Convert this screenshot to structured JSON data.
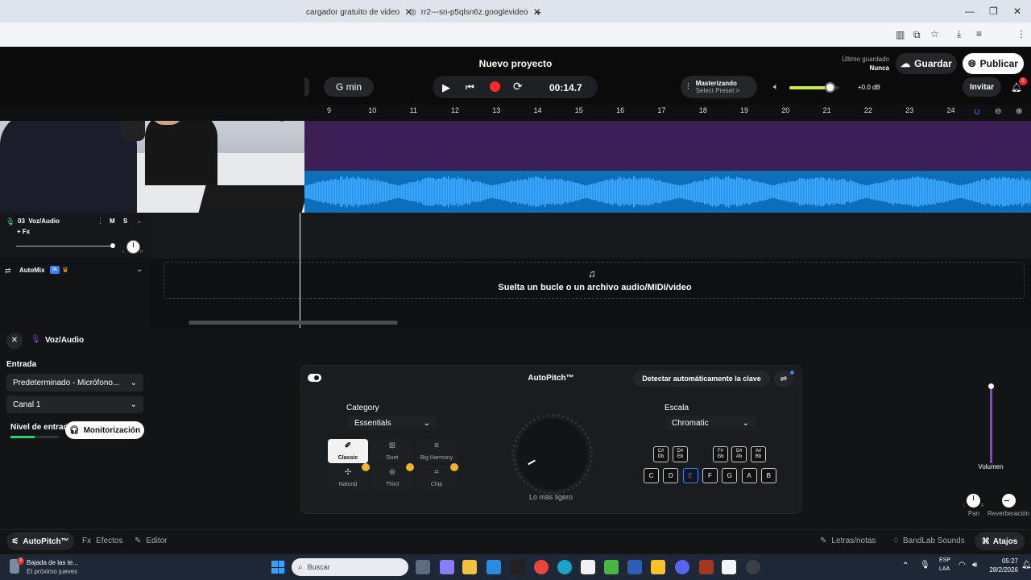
{
  "browser": {
    "tabs": [
      {
        "label": "cargador gratuito de video"
      },
      {
        "label": "rr2---sn-p5qlsn6z.googlevideo"
      }
    ],
    "new_tab": "+"
  },
  "header": {
    "project_title": "Nuevo proyecto",
    "key": "G min",
    "time": "00:14.7",
    "mastering_label": "Masterizando",
    "mastering_preset": "Select Preset >",
    "volume_db": "+0.0 dB",
    "last_saved_label": "Último guardado",
    "last_saved_value": "Nunca",
    "save_label": "Guardar",
    "publish_label": "Publicar",
    "invite_label": "Invitar",
    "notif_count": "1",
    "master_volume": 0.8
  },
  "ruler": [
    "9",
    "10",
    "11",
    "12",
    "13",
    "14",
    "15",
    "16",
    "17",
    "18",
    "19",
    "20",
    "21",
    "22",
    "23",
    "24"
  ],
  "track": {
    "name": "03  Voz/Audio",
    "m": "M",
    "s": "S",
    "fx": "+ Fx",
    "pan_l": "L",
    "pan_r": "R"
  },
  "automix": {
    "label": "AutoMix",
    "badge": "IA"
  },
  "dropzone": {
    "text": "Suelta un bucle o un archivo audio/MIDI/video"
  },
  "editor": {
    "title": "Voz/Audio",
    "input_label": "Entrada",
    "input_device": "Predeterminado - Micrófono...",
    "channel": "Canal 1",
    "level_label": "Nivel de entrada",
    "monitor_label": "Monitorización",
    "autopitch_title": "AutoPitch™",
    "detect_key": "Detectar automáticamente la clave",
    "category_label": "Category",
    "category_value": "Essentials",
    "categories": [
      {
        "label": "Classic"
      },
      {
        "label": "Duet"
      },
      {
        "label": "Big Harmony"
      },
      {
        "label": "Natural"
      },
      {
        "label": "Third"
      },
      {
        "label": "Chip"
      }
    ],
    "knob_label": "Lo más ligero",
    "scale_label": "Escala",
    "scale_value": "Chromatic",
    "sharp_keys": [
      {
        "top": "C#",
        "bottom": "Db"
      },
      {
        "top": "D#",
        "bottom": "Eb"
      },
      {
        "top": "F#",
        "bottom": "Gb"
      },
      {
        "top": "G#",
        "bottom": "Ab"
      },
      {
        "top": "A#",
        "bottom": "Bb"
      }
    ],
    "natural_keys": [
      "C",
      "D",
      "E",
      "F",
      "G",
      "A",
      "B"
    ],
    "volume_label": "Volumen",
    "pan_label": "Pan",
    "reverb_label": "Reverberación",
    "pan_l": "L",
    "pan_r": "R"
  },
  "bottombar": {
    "autopitch": "AutoPitch™",
    "effects": "Efectos",
    "editor": "Editor",
    "lyrics": "Letras/notas",
    "sounds": "BandLab Sounds",
    "shortcuts": "Atajos"
  },
  "taskbar": {
    "weather_title": "Bajada de las te...",
    "weather_sub": "El próximo jueves",
    "search": "Buscar",
    "lang": "ESP",
    "lang2": "LAA",
    "time": "05:27",
    "date": "28/2/2026"
  },
  "colors": {
    "accent_purple": "#8b3fd6",
    "waveform_blue": "#2ea1ff",
    "record_red": "#ff2a2a"
  }
}
